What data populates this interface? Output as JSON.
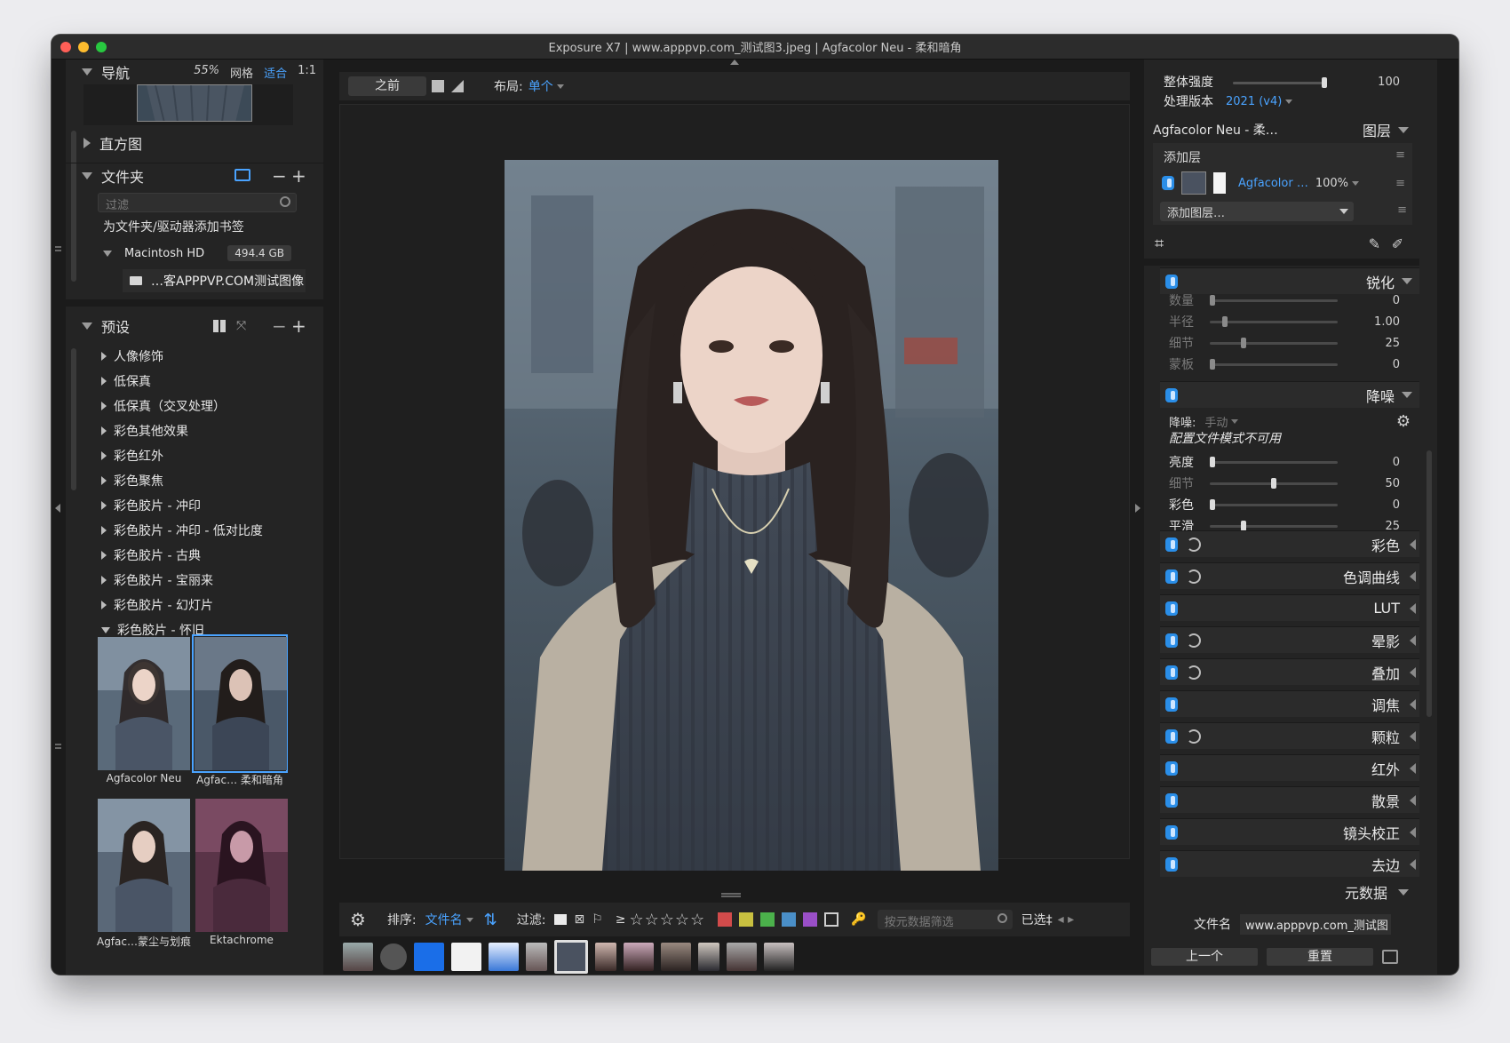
{
  "window": {
    "title": "Exposure X7 | www.apppvp.com_测试图3.jpeg | Agfacolor Neu - 柔和暗角"
  },
  "left": {
    "navigator": {
      "label": "导航",
      "zoom": "55%",
      "grid": "网格",
      "fit": "适合",
      "one_to_one": "1:1"
    },
    "histogram": {
      "label": "直方图"
    },
    "folders": {
      "label": "文件夹",
      "filter_placeholder": "过滤",
      "bookmark_hint": "为文件夹/驱动器添加书签",
      "drive_name": "Macintosh HD",
      "drive_size": "494.4 GB",
      "folder_name": "…客APPPVP.COM测试图像"
    },
    "presets": {
      "label": "预设",
      "items": [
        "人像修饰",
        "低保真",
        "低保真（交叉处理）",
        "彩色其他效果",
        "彩色红外",
        "彩色聚焦",
        "彩色胶片 - 冲印",
        "彩色胶片 - 冲印 - 低对比度",
        "彩色胶片 - 古典",
        "彩色胶片 - 宝丽来",
        "彩色胶片 - 幻灯片",
        "彩色胶片 - 怀旧"
      ],
      "thumbs": [
        "Agfacolor Neu",
        "Agfac… 柔和暗角",
        "Agfac…蒙尘与划痕",
        "Ektachrome"
      ]
    }
  },
  "center": {
    "before_label": "之前",
    "layout_label": "布局:",
    "layout_value": "单个",
    "sort_label": "排序:",
    "sort_value": "文件名",
    "filter_label": "过滤:",
    "gte": "≥",
    "stars": "☆☆☆☆☆",
    "metadata_filter_placeholder": "按元数据筛选",
    "selected_label": "已选‡",
    "color_labels": [
      "#d24b4b",
      "#c8c040",
      "#4bb14b",
      "#4a8fc8",
      "#9a4fc8"
    ]
  },
  "right": {
    "overall_strength_label": "整体强度",
    "overall_strength_value": "100",
    "process_version_label": "处理版本",
    "process_version_value": "2021 (v4)",
    "preset_name": "Agfacolor Neu - 柔…",
    "layers_label": "图层",
    "add_layer_title": "添加层",
    "layer_name": "Agfacolor …",
    "layer_opacity": "100%",
    "add_layer_dropdown": "添加图层…",
    "sharpen": {
      "label": "锐化",
      "rows": [
        {
          "label": "数量",
          "value": "0",
          "pos": 0.0
        },
        {
          "label": "半径",
          "value": "1.00",
          "pos": 0.1
        },
        {
          "label": "细节",
          "value": "25",
          "pos": 0.25
        },
        {
          "label": "蒙板",
          "value": "0",
          "pos": 0.0
        }
      ]
    },
    "noise": {
      "label": "降噪",
      "mode_label": "降噪:",
      "mode_value": "手动",
      "profile_note": "配置文件模式不可用",
      "rows": [
        {
          "label": "亮度",
          "value": "0",
          "pos": 0.0
        },
        {
          "label": "细节",
          "value": "50",
          "pos": 0.5
        },
        {
          "label": "彩色",
          "value": "0",
          "pos": 0.0
        },
        {
          "label": "平滑",
          "value": "25",
          "pos": 0.25
        }
      ]
    },
    "panels": [
      "彩色",
      "色调曲线",
      "LUT",
      "晕影",
      "叠加",
      "调焦",
      "颗粒",
      "红外",
      "散景",
      "镜头校正",
      "去边"
    ],
    "metadata_label": "元数据",
    "filename_label": "文件名",
    "filename_value": "www.apppvp.com_测试图",
    "prev_button": "上一个",
    "reset_button": "重置"
  }
}
